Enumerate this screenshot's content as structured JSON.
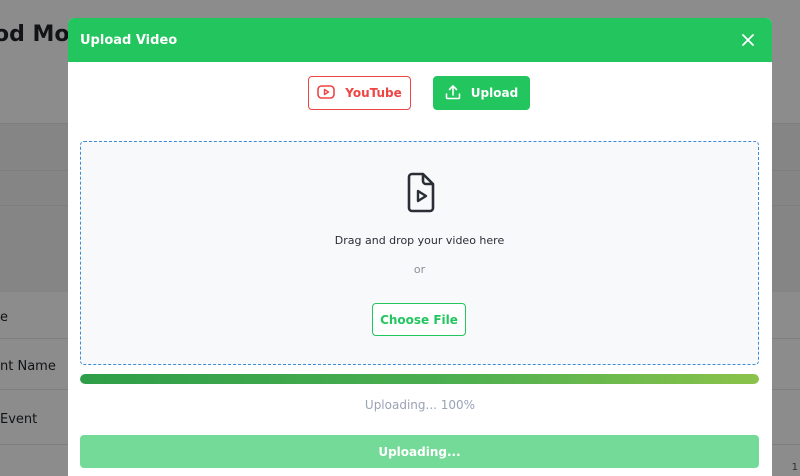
{
  "background": {
    "page_title": "od Mon",
    "rows": [
      "e",
      "nt Name",
      " Event"
    ],
    "corner_text": "1"
  },
  "modal": {
    "title": "Upload Video",
    "close_icon": "close-icon",
    "tabs": {
      "youtube": {
        "label": "YouTube",
        "icon": "youtube-play-icon"
      },
      "upload": {
        "label": "Upload",
        "icon": "upload-icon"
      }
    },
    "dropzone": {
      "icon": "video-file-icon",
      "prompt": "Drag and drop your video here",
      "or": "or",
      "choose_button": "Choose File"
    },
    "progress": {
      "percent": 100,
      "label": "Uploading... 100%"
    },
    "submit_button": "Uploading..."
  },
  "colors": {
    "accent": "#22c55e",
    "youtube": "#ef4444",
    "dropzone_border": "#3b8bd9",
    "disabled_button": "#74da97"
  }
}
